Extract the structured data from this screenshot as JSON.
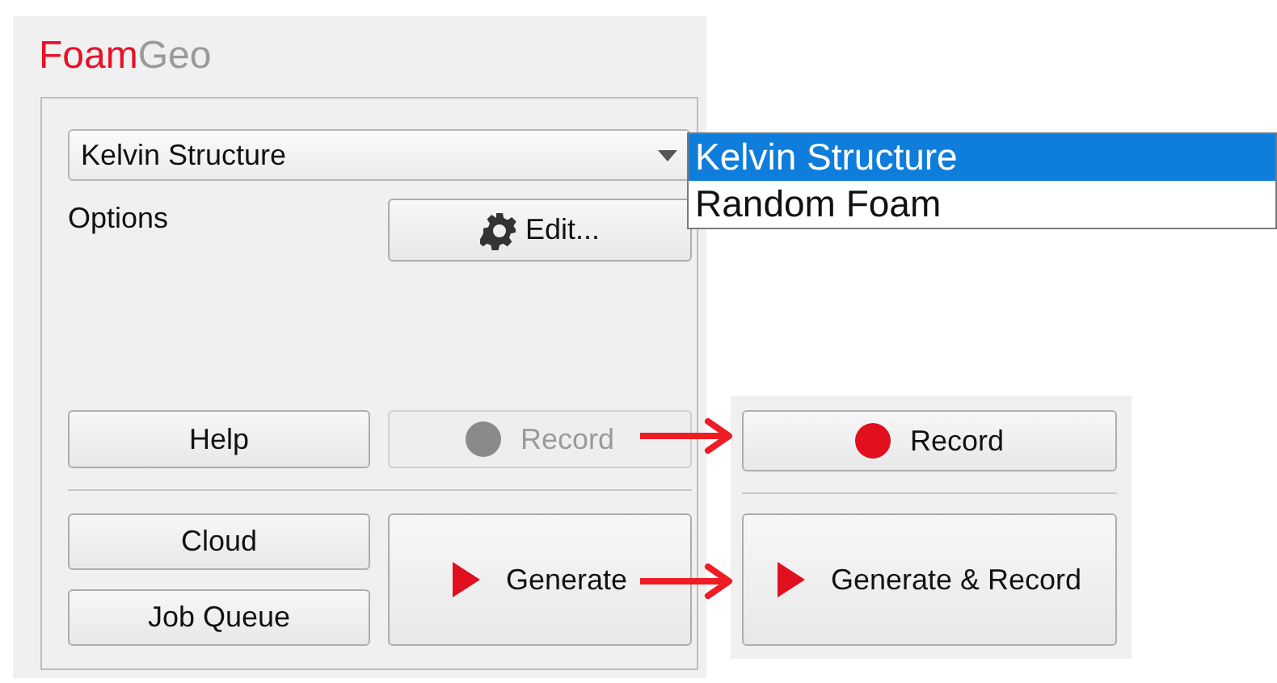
{
  "logo": {
    "part_1": "Foam",
    "part_2": "Geo"
  },
  "combo": {
    "value": "Kelvin Structure"
  },
  "dropdown": [
    {
      "label": "Kelvin Structure",
      "selected": true
    },
    {
      "label": "Random Foam",
      "selected": false
    }
  ],
  "options_label": "Options",
  "edit_button": "Edit...",
  "buttons_before": [
    {
      "label": "Help",
      "kind": "plain",
      "disabled": false
    },
    {
      "label": "Record",
      "kind": "record",
      "disabled": true
    },
    {
      "label": "Cloud",
      "kind": "plain",
      "disabled": false
    },
    {
      "label": "Generate",
      "kind": "generate",
      "disabled": false
    },
    {
      "label": "Job Queue",
      "kind": "plain",
      "disabled": false
    }
  ],
  "buttons_after": [
    {
      "label": "Record",
      "kind": "record",
      "disabled": false
    },
    {
      "label": "Generate & Record",
      "kind": "generate",
      "disabled": false
    }
  ]
}
